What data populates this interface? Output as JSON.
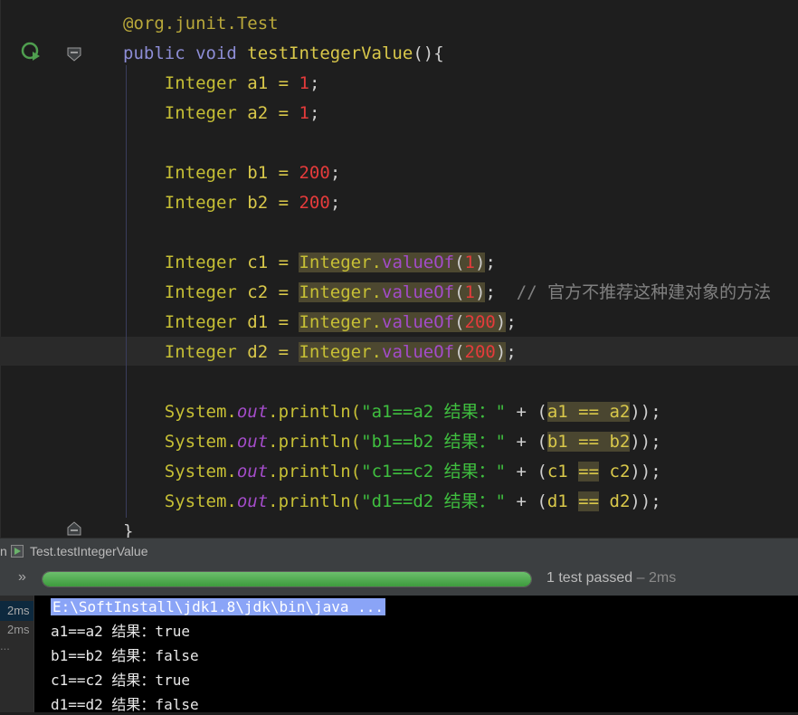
{
  "editor": {
    "lines": [
      {
        "tokens": [
          {
            "t": "@org.junit.",
            "c": "tok-anno"
          },
          {
            "t": "Test",
            "c": "tok-anno"
          }
        ]
      },
      {
        "tokens": [
          {
            "t": "public void ",
            "c": "tok-kw"
          },
          {
            "t": "testIntegerValue",
            "c": "tok-fn"
          },
          {
            "t": "(){",
            "c": "tok-punc"
          }
        ]
      },
      {
        "tokens": [
          {
            "t": "    Integer ",
            "c": "tok-type"
          },
          {
            "t": "a1 = ",
            "c": "tok-var"
          },
          {
            "t": "1",
            "c": "tok-num"
          },
          {
            "t": ";",
            "c": "tok-punc"
          }
        ]
      },
      {
        "tokens": [
          {
            "t": "    Integer ",
            "c": "tok-type"
          },
          {
            "t": "a2 = ",
            "c": "tok-var"
          },
          {
            "t": "1",
            "c": "tok-num"
          },
          {
            "t": ";",
            "c": "tok-punc"
          }
        ]
      },
      {
        "tokens": []
      },
      {
        "tokens": [
          {
            "t": "    Integer ",
            "c": "tok-type"
          },
          {
            "t": "b1 = ",
            "c": "tok-var"
          },
          {
            "t": "200",
            "c": "tok-num"
          },
          {
            "t": ";",
            "c": "tok-punc"
          }
        ]
      },
      {
        "tokens": [
          {
            "t": "    Integer ",
            "c": "tok-type"
          },
          {
            "t": "b2 = ",
            "c": "tok-var"
          },
          {
            "t": "200",
            "c": "tok-num"
          },
          {
            "t": ";",
            "c": "tok-punc"
          }
        ]
      },
      {
        "tokens": []
      },
      {
        "tokens": [
          {
            "t": "    Integer ",
            "c": "tok-type"
          },
          {
            "t": "c1 = ",
            "c": "tok-var"
          },
          {
            "t": "Integer.",
            "c": "tok-cls hl"
          },
          {
            "t": "valueOf",
            "c": "tok-meth hl"
          },
          {
            "t": "(",
            "c": "tok-punc hl"
          },
          {
            "t": "1",
            "c": "tok-num hl"
          },
          {
            "t": ")",
            "c": "tok-punc hl"
          },
          {
            "t": ";",
            "c": "tok-punc"
          }
        ]
      },
      {
        "tokens": [
          {
            "t": "    Integer ",
            "c": "tok-type"
          },
          {
            "t": "c2 = ",
            "c": "tok-var"
          },
          {
            "t": "Integer.",
            "c": "tok-cls hl"
          },
          {
            "t": "valueOf",
            "c": "tok-meth hl"
          },
          {
            "t": "(",
            "c": "tok-punc hl"
          },
          {
            "t": "1",
            "c": "tok-num hl"
          },
          {
            "t": ")",
            "c": "tok-punc hl"
          },
          {
            "t": ";  ",
            "c": "tok-punc"
          },
          {
            "t": "// 官方不推荐这种建对象的方法",
            "c": "tok-com"
          }
        ]
      },
      {
        "tokens": [
          {
            "t": "    Integer ",
            "c": "tok-type"
          },
          {
            "t": "d1 = ",
            "c": "tok-var"
          },
          {
            "t": "Integer.",
            "c": "tok-cls hl"
          },
          {
            "t": "valueOf",
            "c": "tok-meth hl"
          },
          {
            "t": "(",
            "c": "tok-punc hl"
          },
          {
            "t": "200",
            "c": "tok-num hl"
          },
          {
            "t": ")",
            "c": "tok-punc hl"
          },
          {
            "t": ";",
            "c": "tok-punc"
          }
        ]
      },
      {
        "tokens": [
          {
            "t": "    Integer ",
            "c": "tok-type"
          },
          {
            "t": "d2 = ",
            "c": "tok-var"
          },
          {
            "t": "Integer.",
            "c": "tok-cls hl"
          },
          {
            "t": "valueOf",
            "c": "tok-meth hl"
          },
          {
            "t": "(",
            "c": "tok-punc hl"
          },
          {
            "t": "200",
            "c": "tok-num hl"
          },
          {
            "t": ")",
            "c": "tok-punc hl"
          },
          {
            "t": ";",
            "c": "tok-punc"
          }
        ]
      },
      {
        "tokens": []
      },
      {
        "tokens": [
          {
            "t": "    System.",
            "c": "tok-sys"
          },
          {
            "t": "out",
            "c": "tok-field"
          },
          {
            "t": ".println(",
            "c": "tok-call"
          },
          {
            "t": "\"a1==a2 结果：\"",
            "c": "tok-str"
          },
          {
            "t": " + (",
            "c": "tok-punc"
          },
          {
            "t": "a1 == a2",
            "c": "tok-var hl2"
          },
          {
            "t": "));",
            "c": "tok-punc"
          }
        ]
      },
      {
        "tokens": [
          {
            "t": "    System.",
            "c": "tok-sys"
          },
          {
            "t": "out",
            "c": "tok-field"
          },
          {
            "t": ".println(",
            "c": "tok-call"
          },
          {
            "t": "\"b1==b2 结果：\"",
            "c": "tok-str"
          },
          {
            "t": " + (",
            "c": "tok-punc"
          },
          {
            "t": "b1 == b2",
            "c": "tok-var hl2"
          },
          {
            "t": "));",
            "c": "tok-punc"
          }
        ]
      },
      {
        "tokens": [
          {
            "t": "    System.",
            "c": "tok-sys"
          },
          {
            "t": "out",
            "c": "tok-field"
          },
          {
            "t": ".println(",
            "c": "tok-call"
          },
          {
            "t": "\"c1==c2 结果：\"",
            "c": "tok-str"
          },
          {
            "t": " + (",
            "c": "tok-punc"
          },
          {
            "t": "c1 ",
            "c": "tok-var"
          },
          {
            "t": "==",
            "c": "tok-var hl2"
          },
          {
            "t": " c2",
            "c": "tok-var"
          },
          {
            "t": "));",
            "c": "tok-punc"
          }
        ]
      },
      {
        "tokens": [
          {
            "t": "    System.",
            "c": "tok-sys"
          },
          {
            "t": "out",
            "c": "tok-field"
          },
          {
            "t": ".println(",
            "c": "tok-call"
          },
          {
            "t": "\"d1==d2 结果：\"",
            "c": "tok-str"
          },
          {
            "t": " + (",
            "c": "tok-punc"
          },
          {
            "t": "d1 ",
            "c": "tok-var"
          },
          {
            "t": "==",
            "c": "tok-var hl2"
          },
          {
            "t": " d2",
            "c": "tok-var"
          },
          {
            "t": "));",
            "c": "tok-punc"
          }
        ]
      },
      {
        "tokens": [
          {
            "t": "}",
            "c": "tok-punc"
          }
        ]
      }
    ]
  },
  "run_panel": {
    "edge_label": "n",
    "tab_label": "Test.testIntegerValue",
    "progress_fraction": 1.0,
    "status_main": "1 test passed",
    "status_time": " – 2ms",
    "left_times": [
      "2ms",
      "2ms"
    ],
    "left_dots": "...",
    "console_lines": [
      "E:\\SoftInstall\\jdk1.8\\jdk\\bin\\java ...",
      "a1==a2 结果：true",
      "b1==b2 结果：false",
      "c1==c2 结果：true",
      "d1==d2 结果：false"
    ]
  },
  "colors": {
    "progress": "#3d9a3d",
    "highlight": "#4d4830",
    "console_cmd_bg": "#8aa4f7"
  },
  "icons": [
    "run-gutter-icon",
    "fold-icon",
    "test-tab-icon",
    "expand-chevron-icon"
  ]
}
